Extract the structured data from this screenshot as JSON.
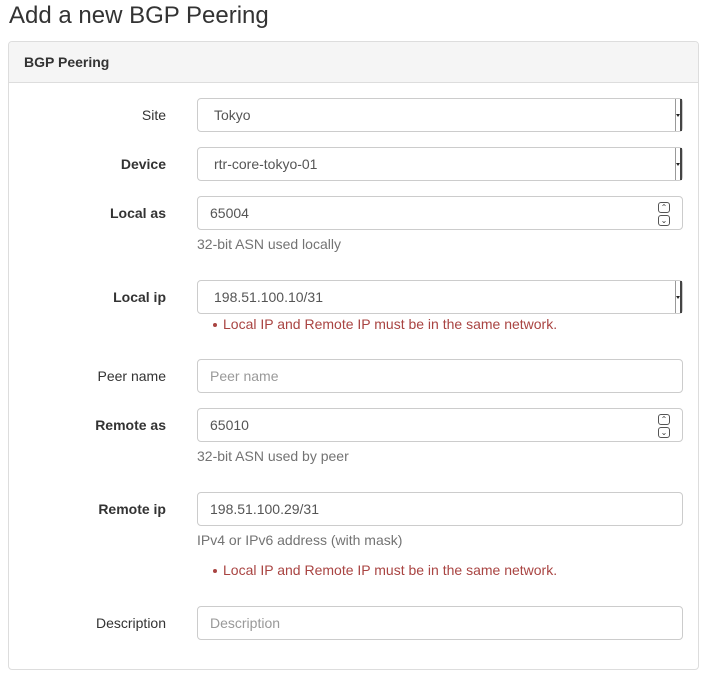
{
  "page": {
    "title": "Add a new BGP Peering"
  },
  "panel": {
    "heading": "BGP Peering"
  },
  "form": {
    "site": {
      "label": "Site",
      "value": "Tokyo"
    },
    "device": {
      "label": "Device",
      "value": "rtr-core-tokyo-01"
    },
    "local_as": {
      "label": "Local as",
      "value": "65004",
      "help": "32-bit ASN used locally"
    },
    "local_ip": {
      "label": "Local ip",
      "value": "198.51.100.10/31",
      "error": "Local IP and Remote IP must be in the same network."
    },
    "peer_name": {
      "label": "Peer name",
      "value": "",
      "placeholder": "Peer name"
    },
    "remote_as": {
      "label": "Remote as",
      "value": "65010",
      "help": "32-bit ASN used by peer"
    },
    "remote_ip": {
      "label": "Remote ip",
      "value": "198.51.100.29/31",
      "help": "IPv4 or IPv6 address (with mask)",
      "error": "Local IP and Remote IP must be in the same network."
    },
    "description": {
      "label": "Description",
      "value": "",
      "placeholder": "Description"
    }
  },
  "icons": {
    "spin_up": "chevron-up-icon",
    "spin_down": "chevron-down-icon",
    "select_arrow": "caret-down-icon"
  },
  "colors": {
    "error": "#a94442",
    "help": "#737373",
    "border": "#cccccc",
    "panel_heading_bg": "#f5f5f5"
  }
}
